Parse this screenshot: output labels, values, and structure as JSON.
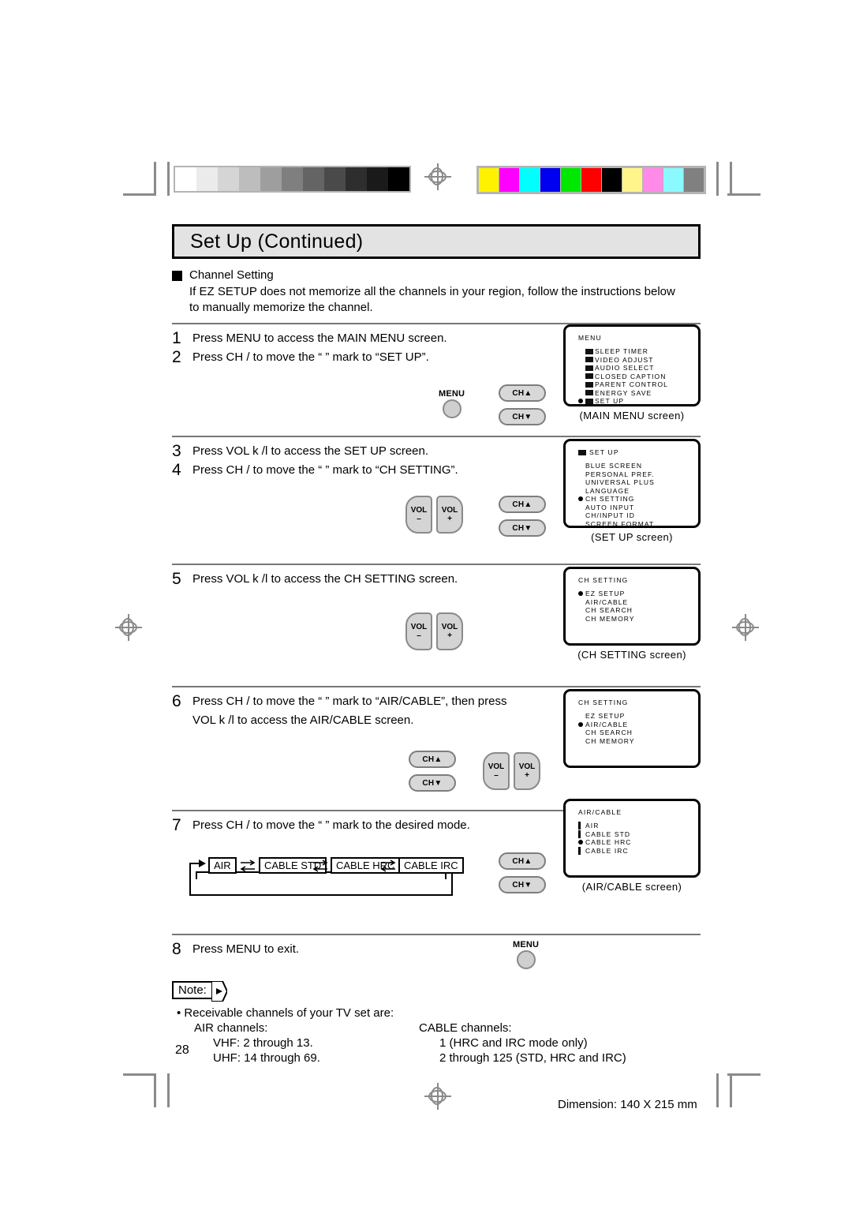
{
  "document": {
    "title": "Set Up (Continued)",
    "page_number": "28",
    "dimension_note": "Dimension: 140  X 215 mm"
  },
  "section": {
    "heading": "Channel Setting",
    "intro_line1": "If EZ SETUP does not memorize all the channels in your region, follow the instructions below",
    "intro_line2": "to manually memorize the channel."
  },
  "steps": {
    "s1": {
      "num": "1",
      "text": "Press MENU to access the MAIN MENU screen."
    },
    "s2": {
      "num": "2",
      "text": "Press CH   /    to move the “    ” mark to “SET UP”."
    },
    "s3": {
      "num": "3",
      "text": "Press VOL k  /l    to access the SET UP screen."
    },
    "s4": {
      "num": "4",
      "text": "Press CH   /    to move the “    ” mark to “CH SETTING”."
    },
    "s5": {
      "num": "5",
      "text": "Press VOL k  /l    to access the CH SETTING screen."
    },
    "s6": {
      "num": "6",
      "line1": "Press CH   /    to move the “    ” mark to “AIR/CABLE”, then press",
      "line2": "VOL k  /l    to access the AIR/CABLE screen."
    },
    "s7": {
      "num": "7",
      "text": "Press CH   /    to move the “    ” mark to the desired mode."
    },
    "s8": {
      "num": "8",
      "text": "Press MENU to exit."
    }
  },
  "buttons": {
    "ch_up": "CH▲",
    "ch_down": "CH▼",
    "vol_minus_label": "VOL",
    "vol_minus_sign": "–",
    "vol_plus_label": "VOL",
    "vol_plus_sign": "+",
    "menu": "MENU"
  },
  "osd": {
    "main_menu": {
      "title": "MENU",
      "caption": "(MAIN  MENU  screen)",
      "items": [
        {
          "label": "SLEEP TIMER",
          "icon": "sleep-timer-icon",
          "marker": "none"
        },
        {
          "label": "VIDEO ADJUST",
          "icon": "video-adjust-icon",
          "marker": "none"
        },
        {
          "label": "AUDIO SELECT",
          "icon": "audio-select-icon",
          "marker": "none"
        },
        {
          "label": "CLOSED CAPTION",
          "icon": "closed-caption-icon",
          "marker": "none"
        },
        {
          "label": "PARENT CONTROL",
          "icon": "parent-control-icon",
          "marker": "none"
        },
        {
          "label": "ENERGY SAVE",
          "icon": "energy-save-icon",
          "marker": "none"
        },
        {
          "label": "SET UP",
          "icon": "set-up-icon",
          "marker": "bullet"
        }
      ]
    },
    "set_up": {
      "title": "SET UP",
      "title_icon": "set-up-icon",
      "caption": "(SET  UP  screen)",
      "items": [
        {
          "label": "BLUE SCREEN",
          "marker": "none"
        },
        {
          "label": "PERSONAL PREF.",
          "marker": "none"
        },
        {
          "label": "UNIVERSAL PLUS",
          "marker": "none"
        },
        {
          "label": "LANGUAGE",
          "marker": "none"
        },
        {
          "label": "CH SETTING",
          "marker": "bullet"
        },
        {
          "label": "AUTO INPUT",
          "marker": "none"
        },
        {
          "label": "CH/INPUT ID",
          "marker": "none"
        },
        {
          "label": "SCREEN FORMAT",
          "marker": "none"
        }
      ]
    },
    "ch_setting_a": {
      "title": "CH SETTING",
      "caption": "(CH  SETTING  screen)",
      "items": [
        {
          "label": "EZ SETUP",
          "marker": "bullet"
        },
        {
          "label": "AIR/CABLE",
          "marker": "none"
        },
        {
          "label": "CH SEARCH",
          "marker": "none"
        },
        {
          "label": "CH MEMORY",
          "marker": "none"
        }
      ]
    },
    "ch_setting_b": {
      "title": "CH SETTING",
      "caption": "",
      "items": [
        {
          "label": "EZ SETUP",
          "marker": "none"
        },
        {
          "label": "AIR/CABLE",
          "marker": "bullet"
        },
        {
          "label": "CH SEARCH",
          "marker": "none"
        },
        {
          "label": "CH MEMORY",
          "marker": "none"
        }
      ]
    },
    "air_cable": {
      "title": "AIR/CABLE",
      "caption": "(AIR/CABLE  screen)",
      "items": [
        {
          "label": "AIR",
          "marker": "bar"
        },
        {
          "label": "CABLE STD",
          "marker": "bar"
        },
        {
          "label": "CABLE HRC",
          "marker": "bullet"
        },
        {
          "label": "CABLE IRC",
          "marker": "bar"
        }
      ]
    }
  },
  "cycle_diagram": {
    "modes": [
      "AIR",
      "CABLE STD",
      "CABLE HRC",
      "CABLE IRC"
    ]
  },
  "note": {
    "label": "Note:",
    "bullet_line": "• Receivable channels of your TV set are:",
    "air_heading": "AIR channels:",
    "air_vhf": "VHF: 2 through 13.",
    "air_uhf": "UHF: 14 through 69.",
    "cable_heading": "CABLE channels:",
    "cable_1": "1 (HRC and IRC mode only)",
    "cable_2": "2 through 125 (STD, HRC and IRC)"
  },
  "calibration": {
    "gray_steps": [
      "#ffffff",
      "#ebebeb",
      "#d5d5d5",
      "#bdbdbd",
      "#9e9e9e",
      "#7f7f7f",
      "#646464",
      "#4a4a4a",
      "#2e2e2e",
      "#1a1a1a",
      "#000000"
    ],
    "colors": [
      "#fff200",
      "#ff00ff",
      "#00ffff",
      "#0000f0",
      "#00e800",
      "#ff0000",
      "#000000",
      "#fff58a",
      "#ff8ae8",
      "#8afaff",
      "#808080"
    ]
  }
}
